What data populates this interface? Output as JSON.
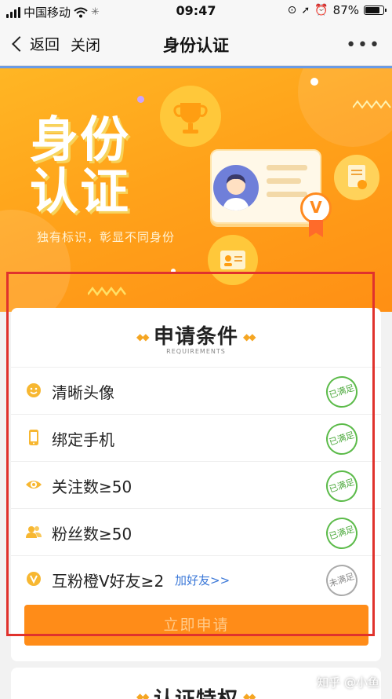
{
  "status_bar": {
    "carrier": "中国移动",
    "time": "09:47",
    "battery": "87%",
    "battery_level": 0.87
  },
  "nav": {
    "back_label": "返回",
    "close_label": "关闭",
    "title": "身份认证",
    "more_label": "•••"
  },
  "banner": {
    "title_line1": "身份",
    "title_line2": "认证",
    "subtitle": "独有标识，彰显不同身份",
    "badge_letter": "V"
  },
  "requirements": {
    "title": "申请条件",
    "subtitle": "REQUIREMENTS",
    "items": [
      {
        "label": "清晰头像",
        "icon": "smiley-icon",
        "status": "已满足"
      },
      {
        "label": "绑定手机",
        "icon": "phone-icon",
        "status": "已满足"
      },
      {
        "label": "关注数≥50",
        "icon": "eye-icon",
        "status": "已满足"
      },
      {
        "label": "粉丝数≥50",
        "icon": "fans-icon",
        "status": "已满足"
      },
      {
        "label": "互粉橙V好友≥2",
        "icon": "orange-v-icon",
        "status": "未满足",
        "link": "加好友>>"
      }
    ],
    "apply_label": "立即申请"
  },
  "privileges": {
    "title": "认证特权"
  },
  "watermark": "知乎 @小鱼",
  "colors": {
    "accent": "#ff8c18",
    "banner": "#ffa21a",
    "satisfied": "#4aa83a",
    "unsatisfied": "#888888",
    "link": "#3b78d8",
    "highlight_frame": "#e0322d"
  }
}
